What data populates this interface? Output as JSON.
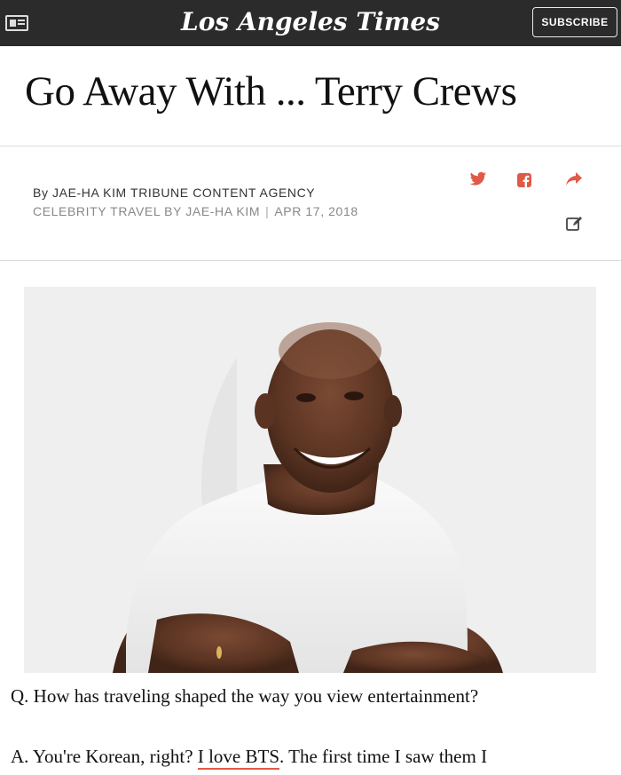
{
  "header": {
    "logo": "Los Angeles Times",
    "subscribe_label": "SUBSCRIBE",
    "menu_icon": "newspaper-menu-icon"
  },
  "article": {
    "title": "Go Away With ... Terry Crews",
    "byline": "By JAE-HA KIM TRIBUNE CONTENT AGENCY",
    "section": "CELEBRITY TRAVEL BY JAE-HA KIM",
    "date": "APR 17, 2018",
    "share_icons": [
      "twitter-icon",
      "facebook-icon",
      "share-arrow-icon",
      "edit-icon"
    ],
    "photo_icon": "portrait-photo",
    "question": "Q. How has traveling shaped the way you view entertainment?",
    "answer_before": "A. You're Korean, right? ",
    "answer_link": "I love BTS",
    "answer_after": ". The first time I saw them I"
  },
  "colors": {
    "topbar": "#2b2b2b",
    "accent": "#e05a47",
    "meta_gray": "#888888"
  }
}
